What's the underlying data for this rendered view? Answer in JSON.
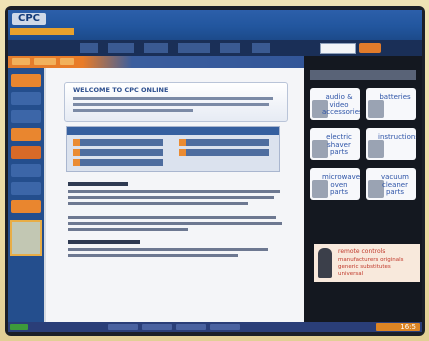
{
  "brand": {
    "logo_text": "CPC"
  },
  "intro": {
    "title": "WELCOME TO CPC ONLINE"
  },
  "tiles": [
    {
      "label": "audio & video accessories",
      "icon": "audio-video-icon"
    },
    {
      "label": "batteries",
      "icon": "battery-icon"
    },
    {
      "label": "electric shaver parts",
      "icon": "shaver-icon"
    },
    {
      "label": "instructions",
      "icon": "book-icon"
    },
    {
      "label": "microwave oven parts",
      "icon": "microwave-icon"
    },
    {
      "label": "vacuum cleaner parts",
      "icon": "vacuum-icon"
    }
  ],
  "promo": {
    "title": "remote controls",
    "lines": [
      "manufacturers originals",
      "generic substitutes",
      "universal"
    ]
  },
  "taskbar": {
    "clock": "16:5"
  },
  "colors": {
    "brand_blue": "#22569e",
    "nav_dark": "#1a2f57",
    "accent_orange": "#e37d2d",
    "tile_text_blue": "#2f55a8",
    "promo_red": "#c0392b"
  }
}
